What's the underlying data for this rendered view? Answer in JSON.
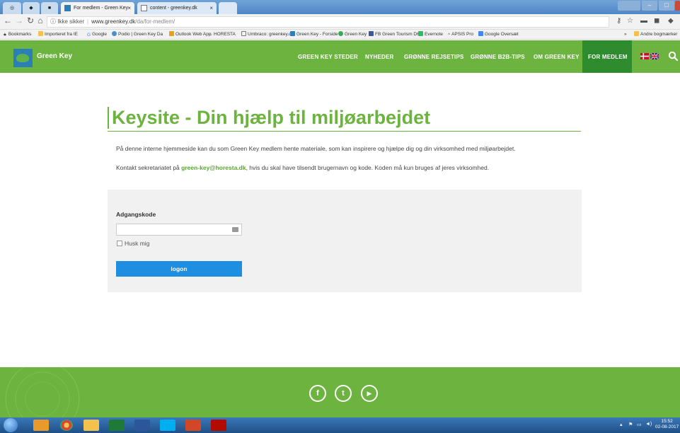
{
  "browser": {
    "tabs": [
      {
        "label": "For medlem - Green Key",
        "active": true
      },
      {
        "label": "content - greenkey.dk",
        "active": false
      }
    ],
    "url": {
      "security": "Ikke sikker",
      "host": "www.greenkey.dk",
      "path": "/da/for-medlem/"
    },
    "bookmarks": [
      "Bookmarks",
      "Importeret fra IE",
      "Google",
      "Podio | Green Key Da",
      "Outlook Web App",
      "HORESTA",
      "Umbraco: greenkey.d",
      "Green Key - Forside",
      "Green Key",
      "FB Green Tourism DK",
      "Evernote",
      "APSIS Pro",
      "Google Oversæt",
      "»",
      "Andre bogmærker"
    ]
  },
  "site": {
    "logo_text": "Green Key",
    "nav": [
      "GREEN KEY STEDER",
      "NYHEDER",
      "GRØNNE REJSETIPS",
      "GRØNNE B2B-TIPS",
      "OM GREEN KEY",
      "FOR MEDLEM"
    ],
    "active_nav": "FOR MEDLEM"
  },
  "content": {
    "title": "Keysite - Din hjælp til miljøarbejdet",
    "para1": "På denne interne hjemmeside kan du som Green Key medlem hente materiale, som kan inspirere og hjælpe dig og din virksomhed med miljøarbejdet.",
    "para2_before": "Kontakt sekretariatet på ",
    "para2_email": "green-key@horesta.dk",
    "para2_after": ", hvis du skal have tilsendt brugernavn og kode. Koden må kun bruges af jeres virksomhed."
  },
  "login": {
    "password_label": "Adgangskode",
    "password_value": "",
    "remember_label": "Husk mig",
    "submit_label": "logon"
  },
  "footer": {
    "social": [
      "f",
      "t",
      "▶"
    ]
  },
  "taskbar": {
    "time": "15:52",
    "date": "02-08-2017"
  },
  "colors": {
    "brand_green": "#6cb43f",
    "active_nav_bg": "#2e8b2e",
    "button_blue": "#1e8ee0"
  }
}
